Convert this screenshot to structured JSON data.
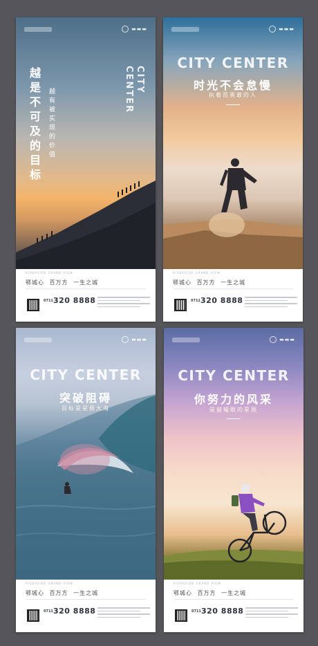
{
  "footer": {
    "riverside": "RIVERSIDE GRAND VIEW",
    "slogan": "鄂城心 百万方 一生之城",
    "area_code": "0711",
    "phone": "320 8888"
  },
  "posters": [
    {
      "city_en_1": "CITY",
      "city_en_2": "CENTER",
      "title": "越是不可及的目标",
      "subtitle": "越有被实现的价值"
    },
    {
      "city_en": "CITY CENTER",
      "title": "时光不会怠慢",
      "subtitle": "执着而勇敢的人"
    },
    {
      "city_en": "CITY CENTER",
      "title": "突破阻碍",
      "subtitle": "目标是星辰大海"
    },
    {
      "city_en": "CITY CENTER",
      "title": "你努力的风采",
      "subtitle": "是最耀眼的星辰"
    }
  ],
  "colors": {
    "background": "#56565a",
    "text_dark": "#2e3440",
    "accent_white": "#ffffff"
  },
  "icons": [
    "brand-logo-icon",
    "qr-code-icon"
  ]
}
